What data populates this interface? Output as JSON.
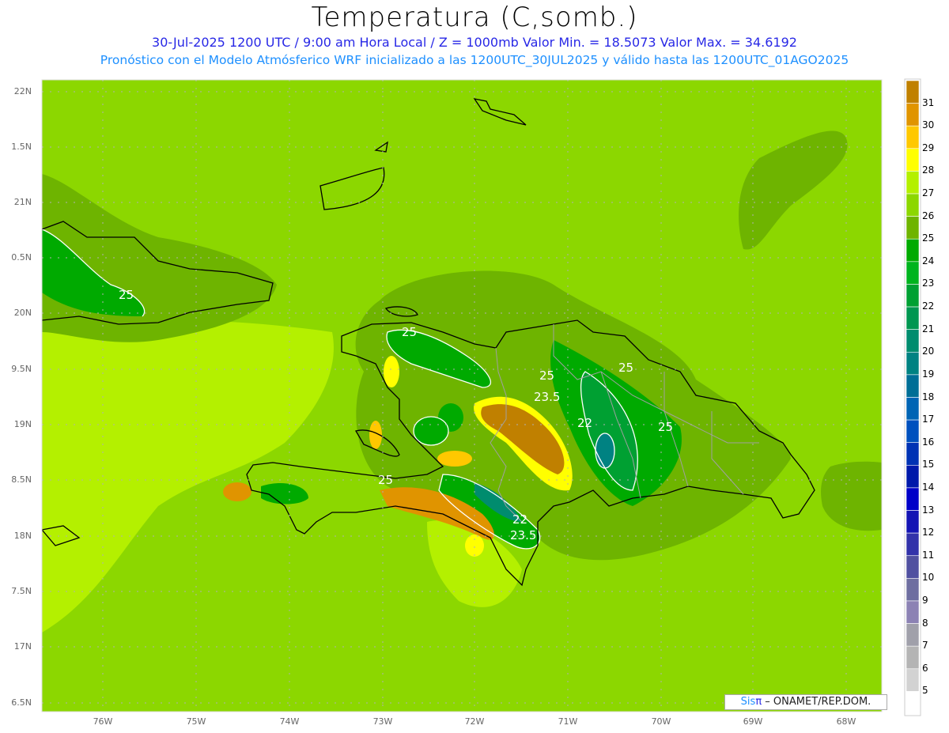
{
  "header": {
    "title": "Temperatura (C,somb.)",
    "subtitle_line1": "30-Jul-2025  1200 UTC / 9:00 am Hora Local / Z = 1000mb   Valor Min. = 18.5073  Valor Max. = 34.6192",
    "subtitle_line2": "Pronóstico con el Modelo Atmósferico WRF inicializado a las 1200UTC_30JUL2025 y válido hasta las  1200UTC_01AGO2025"
  },
  "axes": {
    "lat_labels": [
      "22N",
      "1.5N",
      "21N",
      "0.5N",
      "20N",
      "9.5N",
      "19N",
      "8.5N",
      "18N",
      "7.5N",
      "17N",
      "6.5N"
    ],
    "lon_labels": [
      "76W",
      "75W",
      "74W",
      "73W",
      "72W",
      "71W",
      "70W",
      "69W",
      "68W"
    ]
  },
  "colorbar": {
    "labels": [
      "31",
      "30",
      "29",
      "28",
      "27",
      "26",
      "25",
      "24",
      "23",
      "22",
      "21",
      "20",
      "19",
      "18",
      "17",
      "16",
      "15",
      "14",
      "13",
      "12",
      "11",
      "10",
      "9",
      "8",
      "7",
      "6",
      "5"
    ],
    "colors": [
      "#c08000",
      "#e09400",
      "#ffc800",
      "#ffff00",
      "#b4f000",
      "#8cd700",
      "#6eb400",
      "#00aa00",
      "#00b41e",
      "#00a032",
      "#009650",
      "#008c6e",
      "#008282",
      "#006e96",
      "#0064b4",
      "#0050be",
      "#0032b4",
      "#0019aa",
      "#0000c8",
      "#1414b4",
      "#3232aa",
      "#5050a0",
      "#6e6ea0",
      "#8c82b4",
      "#a0a0aa",
      "#b4b4b4",
      "#d2d2d2",
      "#ffffff"
    ]
  },
  "contour_labels": [
    "25",
    "25",
    "25",
    "25",
    "25",
    "23.5",
    "22",
    "22",
    "23.5",
    "25"
  ],
  "credit": {
    "sis": "Sis",
    "pi": "π",
    "text": "– ONAMET/REP.DOM."
  }
}
